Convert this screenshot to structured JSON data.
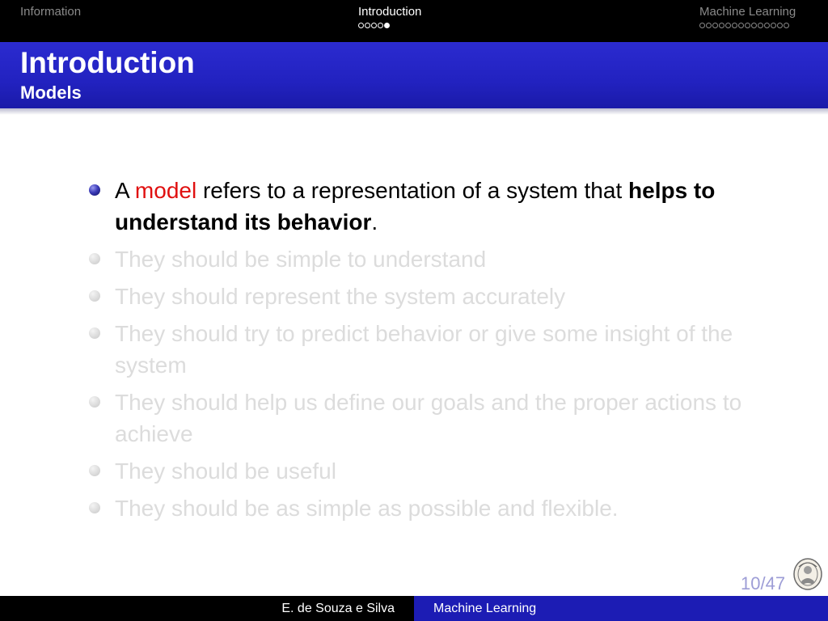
{
  "nav": {
    "sections": [
      {
        "label": "Information",
        "dots": 0,
        "active_dot": null
      },
      {
        "label": "Introduction",
        "dots": 5,
        "active_dot": 4
      },
      {
        "label": "Machine Learning",
        "dots": 14,
        "active_dot": null
      }
    ]
  },
  "frame": {
    "title": "Introduction",
    "subtitle": "Models"
  },
  "bullets": {
    "b1": {
      "p1": "A ",
      "highlight": "model",
      "p2": " refers to a representation of a system that ",
      "bold": "helps to understand its behavior",
      "p3": "."
    },
    "b2": "They should be simple to understand",
    "b3": "They should represent the system accurately",
    "b4": "They should try to predict behavior or give some insight of the system",
    "b5": "They should help us define our goals and the proper actions to achieve",
    "b6": "They should be useful",
    "b7": "They should be as simple as possible and flexible."
  },
  "page_number": "10/47",
  "footer": {
    "author": "E. de Souza e Silva",
    "title": "Machine Learning"
  },
  "colors": {
    "title_bar": "#2222c0",
    "highlight": "#e01010",
    "faded_text": "#dcdcdc",
    "footer_right": "#1c1cb4"
  },
  "icons": {
    "logo": "university-seal-icon",
    "bullet": "ball-bullet-icon"
  }
}
